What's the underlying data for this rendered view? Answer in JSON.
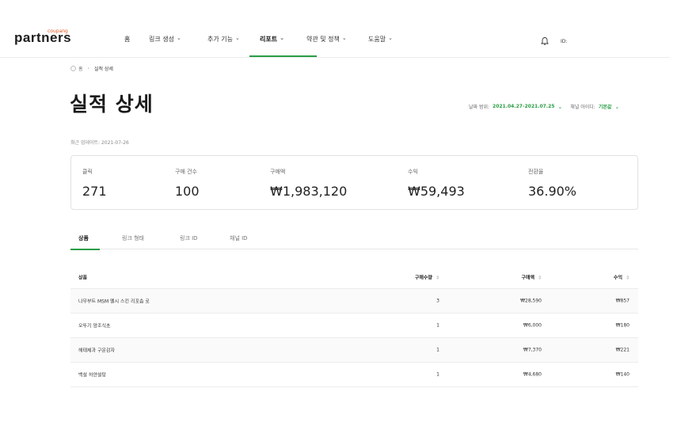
{
  "brand": {
    "small": "coupang",
    "main": "partners"
  },
  "nav": {
    "home": "홈",
    "link_create": "링크 생성",
    "extra": "추가 기능",
    "report": "리포트",
    "terms": "약관 및 정책",
    "help": "도움말"
  },
  "header": {
    "id_label": "ID:"
  },
  "breadcrumb": {
    "home": "홈",
    "current": "실적 상세"
  },
  "title": "실적 상세",
  "filters": {
    "date_label": "날짜 범위:",
    "date_value": "2021.04.27-2021.07.25",
    "channel_label": "채널 아이디:",
    "channel_value": "기본값"
  },
  "updated": "최근 업데이트: 2021-07-26",
  "stats": {
    "clicks_label": "클릭",
    "clicks": "271",
    "orders_label": "구매 건수",
    "orders": "100",
    "amount_label": "구매액",
    "amount": "₩1,983,120",
    "revenue_label": "수익",
    "revenue": "₩59,493",
    "conv_label": "전환율",
    "conv": "36.90%"
  },
  "tabs": [
    "상품",
    "링크 형태",
    "링크 ID",
    "채널 ID"
  ],
  "table": {
    "headers": {
      "product": "상품",
      "qty": "구매수량",
      "amount": "구매액",
      "revenue": "수익"
    },
    "rows": [
      {
        "product": "나무부트 MSM 멜시 스킨 리포솜 로",
        "qty": "3",
        "amount": "₩28,590",
        "revenue": "₩857"
      },
      {
        "product": "오뚜기 양조식초",
        "qty": "1",
        "amount": "₩6,000",
        "revenue": "₩180"
      },
      {
        "product": "해태제과 구운감자",
        "qty": "1",
        "amount": "₩7,370",
        "revenue": "₩221"
      },
      {
        "product": "백설 하얀설탕",
        "qty": "1",
        "amount": "₩4,680",
        "revenue": "₩140"
      }
    ]
  },
  "colors": {
    "accent": "#2a9d44",
    "logo": "#e8561f"
  }
}
